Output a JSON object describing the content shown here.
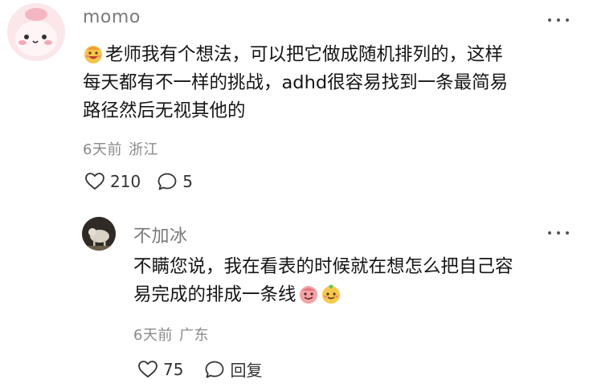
{
  "comments": [
    {
      "username": "momo",
      "text_line1": "老师我有个想法，可以把它做成随机排列的，这样",
      "text_line2": "每天都有不一样的挑战，adhd很容易找到一条最简易",
      "text_line3": "路径然后无视其他的",
      "time": "6天前",
      "location": "浙江",
      "likes": "210",
      "replies": "5"
    },
    {
      "username": "不加冰",
      "text_line1": "不瞒您说，我在看表的时候就在想怎么把自己容",
      "text_line2": "易完成的排成一条线",
      "time": "6天前",
      "location": "广东",
      "likes": "75",
      "reply_label": "回复"
    }
  ],
  "icons": {
    "like": "heart-outline-icon",
    "reply": "speech-bubble-icon",
    "more": "more-dots-icon"
  }
}
